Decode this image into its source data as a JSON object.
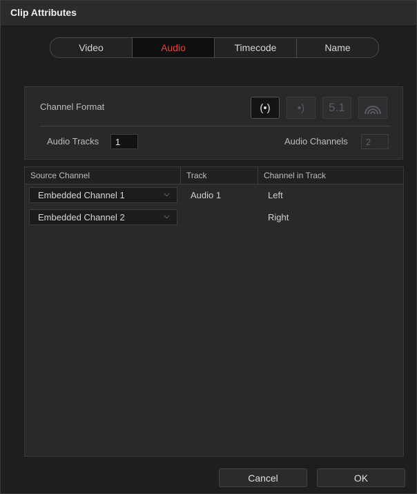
{
  "dialog": {
    "title": "Clip Attributes"
  },
  "tabs": [
    {
      "label": "Video",
      "active": false
    },
    {
      "label": "Audio",
      "active": true
    },
    {
      "label": "Timecode",
      "active": false
    },
    {
      "label": "Name",
      "active": false
    }
  ],
  "format": {
    "channel_format_label": "Channel Format",
    "options": [
      {
        "icon": "mono-icon",
        "glyph": "(•)",
        "active": true
      },
      {
        "icon": "stereo-icon",
        "glyph": "•)",
        "active": false
      },
      {
        "icon": "surround-51-icon",
        "glyph": "5.1",
        "active": false
      },
      {
        "icon": "adaptive-icon",
        "glyph": "◠",
        "active": false
      }
    ],
    "audio_tracks_label": "Audio Tracks",
    "audio_tracks_value": "1",
    "audio_channels_label": "Audio Channels",
    "audio_channels_value": "2"
  },
  "table": {
    "headers": [
      "Source Channel",
      "Track",
      "Channel in Track"
    ],
    "rows": [
      {
        "source": "Embedded Channel 1",
        "track": "Audio 1",
        "channel": "Left"
      },
      {
        "source": "Embedded Channel 2",
        "track": "",
        "channel": "Right"
      }
    ]
  },
  "footer": {
    "cancel_label": "Cancel",
    "ok_label": "OK"
  },
  "colors": {
    "accent": "#e8443a"
  }
}
